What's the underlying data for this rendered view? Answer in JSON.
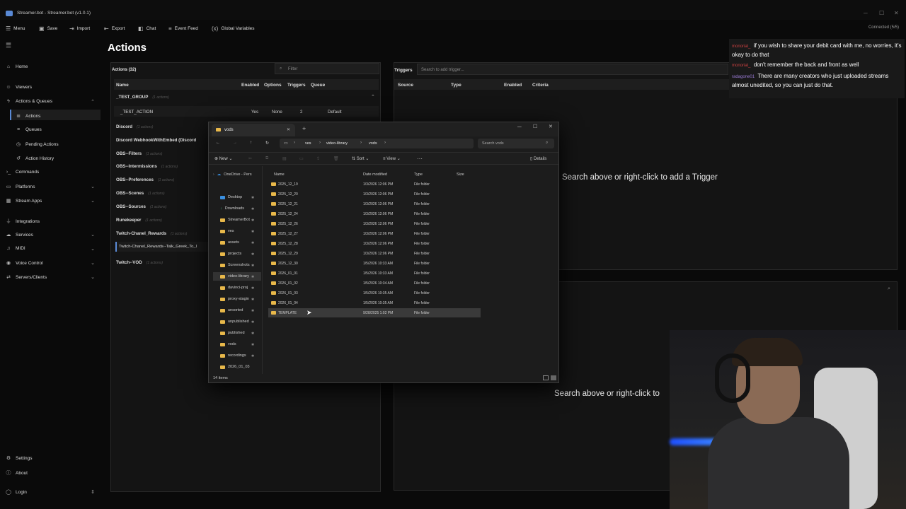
{
  "app": {
    "title": "Streamer.bot - Streamer.bot (v1.0.1)",
    "connected": "Connected (5/5)"
  },
  "menubar": [
    "Menu",
    "Save",
    "Import",
    "Export",
    "Chat",
    "Event Feed",
    "Global Variables"
  ],
  "sidebar": {
    "items": [
      {
        "label": "Home",
        "icon": "home-icon"
      },
      {
        "label": "Viewers",
        "icon": "users-icon"
      },
      {
        "label": "Actions & Queues",
        "icon": "bolt-icon"
      },
      {
        "label": "Actions",
        "icon": "list-icon"
      },
      {
        "label": "Queues",
        "icon": "queue-icon"
      },
      {
        "label": "Pending Actions",
        "icon": "clock-icon"
      },
      {
        "label": "Action History",
        "icon": "history-icon"
      },
      {
        "label": "Commands",
        "icon": "terminal-icon"
      },
      {
        "label": "Platforms",
        "icon": "platform-icon"
      },
      {
        "label": "Stream Apps",
        "icon": "apps-icon"
      },
      {
        "label": "Integrations",
        "icon": "plug-icon"
      },
      {
        "label": "Services",
        "icon": "cloud-icon"
      },
      {
        "label": "MIDI",
        "icon": "midi-icon"
      },
      {
        "label": "Voice Control",
        "icon": "mic-icon"
      },
      {
        "label": "Servers/Clients",
        "icon": "server-icon"
      }
    ],
    "settings": "Settings",
    "about": "About",
    "login": "Login"
  },
  "page": {
    "title": "Actions"
  },
  "actions_panel": {
    "header": "Actions (32)",
    "filter_placeholder": "Filter",
    "columns": [
      "Name",
      "Enabled",
      "Options",
      "Triggers",
      "Queue"
    ],
    "test_group": "_TEST_GROUP",
    "test_group_sub": "(1 actions)",
    "test_action": {
      "name": "_TEST_ACTION",
      "enabled": "Yes",
      "options": "None",
      "triggers": "2",
      "queue": "Default"
    },
    "groups": [
      {
        "name": "Discord",
        "sub": "(1 actions)"
      },
      {
        "name": "Discord WebhookWithEmbed (Discord",
        "sub": ""
      },
      {
        "name": "OBS--Filters",
        "sub": "(1 actions)"
      },
      {
        "name": "OBS--Intermissions",
        "sub": "(1 actions)"
      },
      {
        "name": "OBS--Preferences",
        "sub": "(1 actions)"
      },
      {
        "name": "OBS--Scenes",
        "sub": "(1 actions)"
      },
      {
        "name": "OBS--Sources",
        "sub": "(1 actions)"
      },
      {
        "name": "Runekeeper",
        "sub": "(1 actions)"
      },
      {
        "name": "Twitch-Chanel_Rewards",
        "sub": "(1 actions)"
      }
    ],
    "selected_item": "Twitch-Chanel_Rewards--Talk_Greek_To_I",
    "last_group": {
      "name": "Twitch--VOD",
      "sub": "(1 actions)"
    }
  },
  "triggers_panel": {
    "title": "Triggers",
    "search_placeholder": "Search to add trigger...",
    "columns": [
      "Source",
      "Type",
      "Enabled",
      "Criteria"
    ],
    "hint": "Search above or right-click to add a Trigger"
  },
  "sub_panel": {
    "hint": "Search above or right-click to"
  },
  "chat": [
    {
      "user": "monorial_",
      "text": "if you wish to share your debit card with me, no worries, it's okay to do that"
    },
    {
      "user": "monorial_",
      "text": "don't remember the back and front as well"
    },
    {
      "user": "radagone01",
      "text": "There are many creators who just uploaded streams almost unedited, so you can just do that."
    }
  ],
  "explorer": {
    "tab": "vods",
    "breadcrumb": [
      "ves",
      "video-library",
      "vods"
    ],
    "search_placeholder": "Search vods",
    "toolbar": {
      "new": "New",
      "sort": "Sort",
      "view": "View",
      "details": "Details"
    },
    "columns": [
      "Name",
      "Date modified",
      "Type",
      "Size"
    ],
    "sidebar": [
      "OneDrive - Pers",
      "Desktop",
      "Downloads",
      "StreamerBot",
      "ves",
      "assets",
      "projects",
      "Screenshots",
      "video-library",
      "davinci-proj",
      "proxy-stagin",
      "unsorted",
      "unpublished",
      "published",
      "vods",
      "recordings",
      "2026_01_03"
    ],
    "files": [
      {
        "name": "2025_12_19",
        "date": "1/3/2026 12:06 PM",
        "type": "File folder"
      },
      {
        "name": "2025_12_20",
        "date": "1/3/2026 12:06 PM",
        "type": "File folder"
      },
      {
        "name": "2025_12_21",
        "date": "1/3/2026 12:06 PM",
        "type": "File folder"
      },
      {
        "name": "2025_12_24",
        "date": "1/3/2026 12:06 PM",
        "type": "File folder"
      },
      {
        "name": "2025_12_26",
        "date": "1/3/2026 12:06 PM",
        "type": "File folder"
      },
      {
        "name": "2025_12_27",
        "date": "1/3/2026 12:06 PM",
        "type": "File folder"
      },
      {
        "name": "2025_12_28",
        "date": "1/3/2026 12:06 PM",
        "type": "File folder"
      },
      {
        "name": "2025_12_29",
        "date": "1/3/2026 12:06 PM",
        "type": "File folder"
      },
      {
        "name": "2025_12_30",
        "date": "1/5/2026 10:33 AM",
        "type": "File folder"
      },
      {
        "name": "2026_01_01",
        "date": "1/5/2026 10:33 AM",
        "type": "File folder"
      },
      {
        "name": "2026_01_02",
        "date": "1/5/2026 10:34 AM",
        "type": "File folder"
      },
      {
        "name": "2026_01_03",
        "date": "1/5/2026 10:35 AM",
        "type": "File folder"
      },
      {
        "name": "2026_01_04",
        "date": "1/5/2026 10:35 AM",
        "type": "File folder"
      },
      {
        "name": "TEMPLATE",
        "date": "9/28/2025 1:02 PM",
        "type": "File folder"
      }
    ],
    "status": "14 items"
  },
  "colors": {
    "accent": "#5a8ad6",
    "folder": "#e8b84a",
    "chat_user": "#c94040"
  }
}
